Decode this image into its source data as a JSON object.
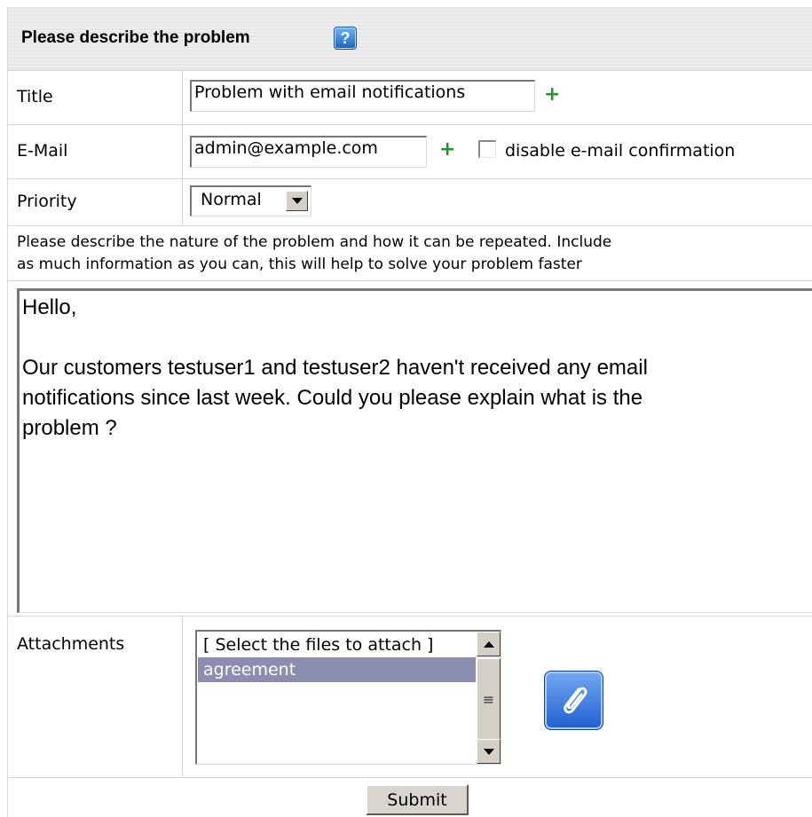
{
  "header": {
    "title": "Please describe the problem",
    "help_icon": "question-mark-icon"
  },
  "fields": {
    "title": {
      "label": "Title",
      "value": "Problem with email notifications"
    },
    "email": {
      "label": "E-Mail",
      "value": "admin@example.com",
      "checkbox_label": "disable e-mail confirmation",
      "checkbox_checked": false
    },
    "priority": {
      "label": "Priority",
      "value": "Normal"
    }
  },
  "description": {
    "instructions_line1": "Please describe the nature of the problem and how it can be repeated. Include",
    "instructions_line2": "as much information as you can, this will help to solve your problem faster",
    "body_lines": [
      "Hello,",
      "",
      "Our customers testuser1 and testuser2 haven't received any email",
      "notifications since last week. Could you please explain what is the",
      "problem ?"
    ]
  },
  "attachments": {
    "label": "Attachments",
    "options": [
      "[ Select the files to attach ]",
      "agreement"
    ],
    "selected_index": 1,
    "attach_icon": "paperclip-icon"
  },
  "submit_label": "Submit",
  "colors": {
    "plus": "#1a9a2a",
    "selection": "#8b8db1",
    "help_icon": "#1a62c4"
  }
}
